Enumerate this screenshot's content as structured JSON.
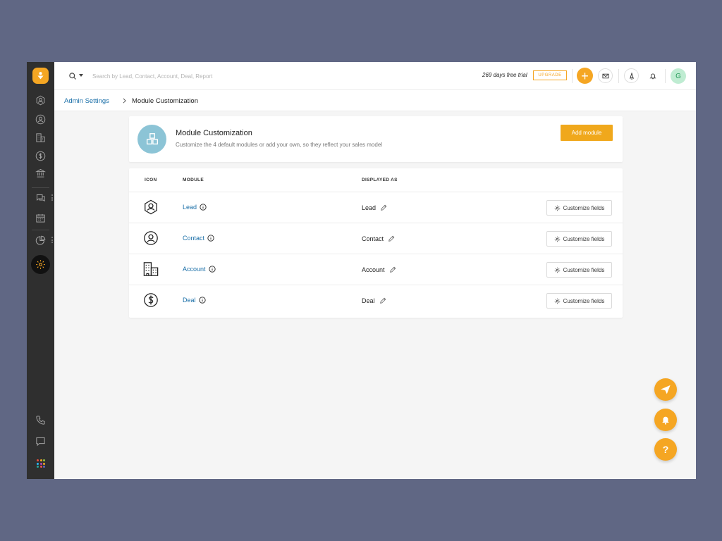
{
  "topbar": {
    "search_placeholder": "Search by Lead, Contact, Account, Deal, Report",
    "trial_text": "269 days free trial",
    "upgrade_label": "UPGRADE",
    "plus_label": "+",
    "avatar_initial": "G"
  },
  "breadcrumb": {
    "parent": "Admin Settings",
    "current": "Module Customization"
  },
  "header": {
    "title": "Module Customization",
    "subtitle": "Customize the 4 default modules or add your own, so they reflect your sales model",
    "add_button": "Add module"
  },
  "table": {
    "columns": {
      "icon": "ICON",
      "module": "MODULE",
      "displayed_as": "DISPLAYED AS"
    },
    "customize_label": "Customize fields",
    "rows": [
      {
        "icon": "lead-icon",
        "module": "Lead",
        "displayed_as": "Lead"
      },
      {
        "icon": "contact-icon",
        "module": "Contact",
        "displayed_as": "Contact"
      },
      {
        "icon": "account-icon",
        "module": "Account",
        "displayed_as": "Account"
      },
      {
        "icon": "deal-icon",
        "module": "Deal",
        "displayed_as": "Deal"
      }
    ]
  },
  "fabs": {
    "help_label": "?"
  },
  "colors": {
    "accent": "#f5a623",
    "link": "#1a6fa8",
    "sidebar_bg": "#2f2f2f",
    "header_icon_bg": "#8cc4d6",
    "avatar_bg": "#bfecd2"
  }
}
